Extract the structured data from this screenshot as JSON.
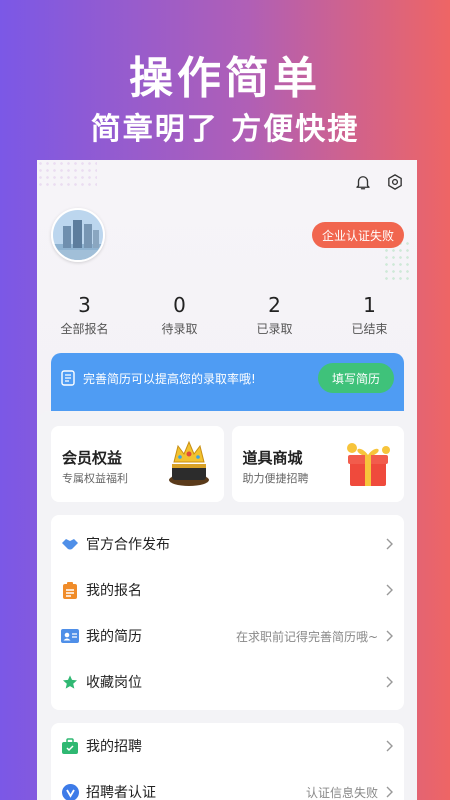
{
  "promo": {
    "title": "操作简单",
    "subtitle": "简章明了 方便快捷"
  },
  "header": {
    "cert_badge": "企业认证失败"
  },
  "stats": [
    {
      "value": "3",
      "label": "全部报名"
    },
    {
      "value": "0",
      "label": "待录取"
    },
    {
      "value": "2",
      "label": "已录取"
    },
    {
      "value": "1",
      "label": "已结束"
    }
  ],
  "notice": {
    "text": "完善简历可以提高您的录取率哦!",
    "button": "填写简历"
  },
  "cards": [
    {
      "title": "会员权益",
      "subtitle": "专属权益福利",
      "icon": "crown-icon"
    },
    {
      "title": "道具商城",
      "subtitle": "助力便捷招聘",
      "icon": "gift-box-icon"
    }
  ],
  "menu1": [
    {
      "label": "官方合作发布",
      "hint": "",
      "icon": "handshake-icon"
    },
    {
      "label": "我的报名",
      "hint": "",
      "icon": "clipboard-icon"
    },
    {
      "label": "我的简历",
      "hint": "在求职前记得完善简历哦~",
      "icon": "id-card-icon"
    },
    {
      "label": "收藏岗位",
      "hint": "",
      "icon": "star-icon"
    }
  ],
  "menu2": [
    {
      "label": "我的招聘",
      "hint": "",
      "icon": "briefcase-icon"
    },
    {
      "label": "招聘者认证",
      "hint": "认证信息失败",
      "icon": "verified-icon"
    }
  ],
  "colors": {
    "badge_red": "#f1664f",
    "notice_blue": "#4f9cf3",
    "button_green": "#3fc27a"
  }
}
